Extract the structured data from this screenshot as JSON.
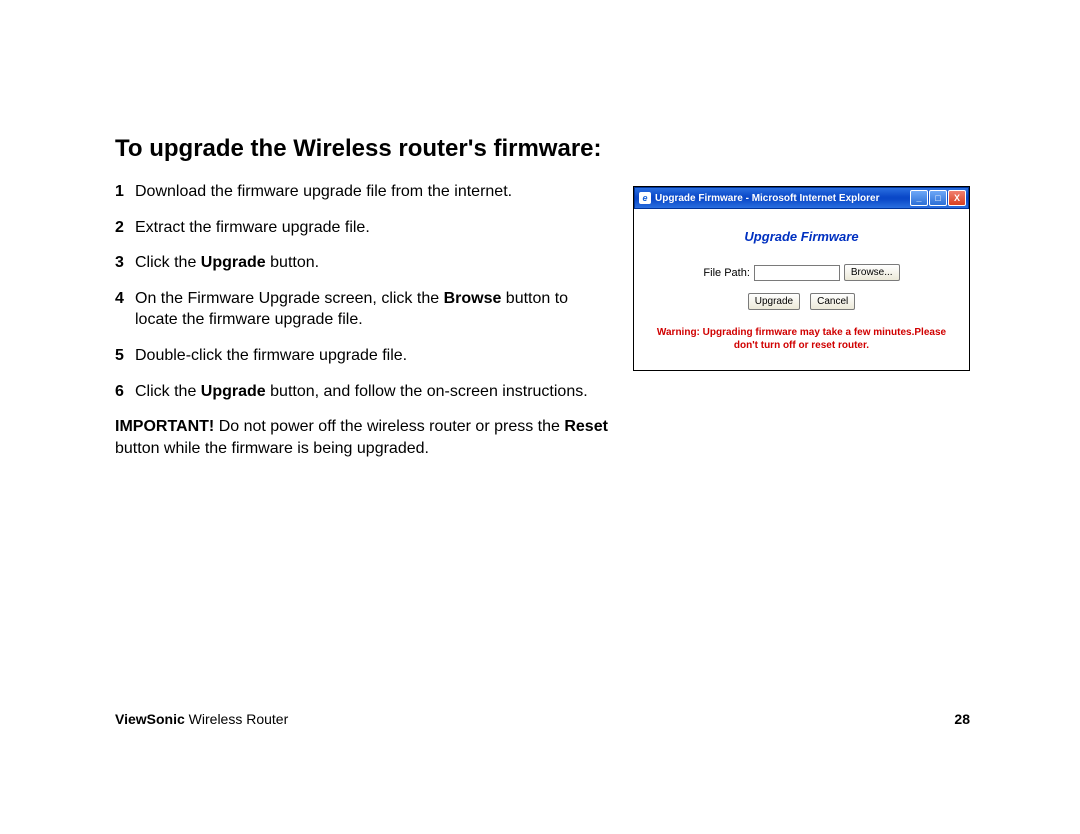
{
  "heading": "To upgrade the Wireless router's firmware:",
  "steps": {
    "1": "Download the firmware upgrade file from the internet.",
    "2": "Extract the firmware upgrade file.",
    "3a": "Click the ",
    "3b": "Upgrade",
    "3c": " button.",
    "4a": "On the Firmware Upgrade screen, click the ",
    "4b": "Browse",
    "4c": " button to locate the firmware upgrade file.",
    "5": "Double-click the firmware upgrade file.",
    "6a": "Click the ",
    "6b": "Upgrade",
    "6c": " button, and follow the on-screen instructions."
  },
  "important": {
    "label": "IMPORTANT!",
    "text1": " Do not power off the wireless router or press the ",
    "reset": "Reset",
    "text2": " button while the firmware is being upgraded."
  },
  "window": {
    "title": "Upgrade Firmware - Microsoft Internet Explorer",
    "ie": "e",
    "min": "_",
    "max": "□",
    "close": "X",
    "panelTitle": "Upgrade Firmware",
    "filePathLabel": "File Path:",
    "browse": "Browse...",
    "upgrade": "Upgrade",
    "cancel": "Cancel",
    "warning": "Warning: Upgrading firmware may take a few minutes.Please don't turn off or reset router."
  },
  "footer": {
    "brand": "ViewSonic",
    "product": " Wireless Router",
    "page": "28"
  }
}
